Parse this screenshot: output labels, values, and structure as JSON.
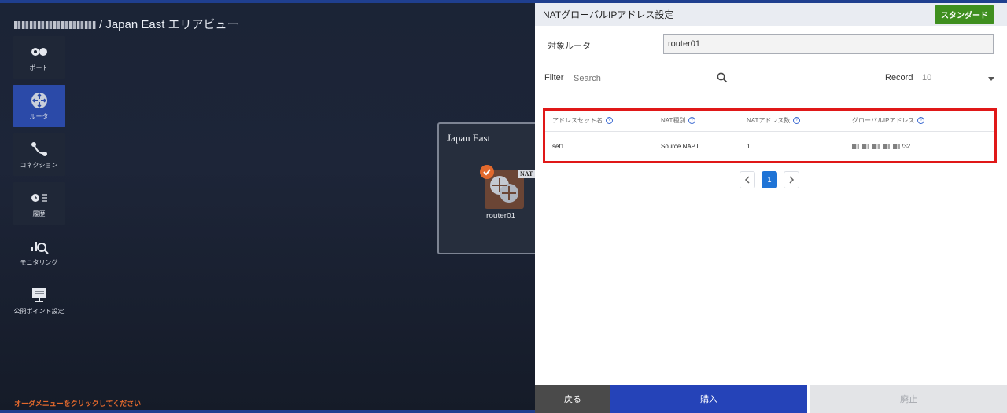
{
  "breadcrumb": {
    "title": "/ Japan East エリアビュー"
  },
  "nav": {
    "items": [
      {
        "label": "ポート",
        "icon": "port-icon"
      },
      {
        "label": "ルータ",
        "icon": "router-icon"
      },
      {
        "label": "コネクション",
        "icon": "connection-icon"
      },
      {
        "label": "履歴",
        "icon": "history-icon"
      },
      {
        "label": "モニタリング",
        "icon": "monitoring-icon"
      },
      {
        "label": "公開ポイント設定",
        "icon": "public-point-icon"
      }
    ]
  },
  "order_hint": "オーダメニューをクリックしてください",
  "canvas": {
    "region_title": "Japan East",
    "router_label": "router01",
    "nat_badge": "NAT"
  },
  "panel": {
    "title": "NATグローバルIPアドレス設定",
    "plan_badge": "スタンダード",
    "target_router_label": "対象ルータ",
    "target_router_value": "router01",
    "filter_label": "Filter",
    "search_placeholder": "Search",
    "record_label": "Record",
    "record_value": "10",
    "table": {
      "headers": [
        "アドレスセット名",
        "NAT種別",
        "NATアドレス数",
        "グローバルIPアドレス"
      ],
      "rows": [
        {
          "name": "set1",
          "nat_type": "Source NAPT",
          "count": "1",
          "ip_suffix": "/32"
        }
      ]
    },
    "pagination": {
      "current": "1"
    },
    "footer": {
      "back": "戻る",
      "buy": "購入",
      "cancel": "廃止"
    }
  },
  "colors": {
    "accent": "#2543b8",
    "highlight": "#e01818",
    "plan": "#3f8f1f",
    "order": "#e2692d"
  }
}
